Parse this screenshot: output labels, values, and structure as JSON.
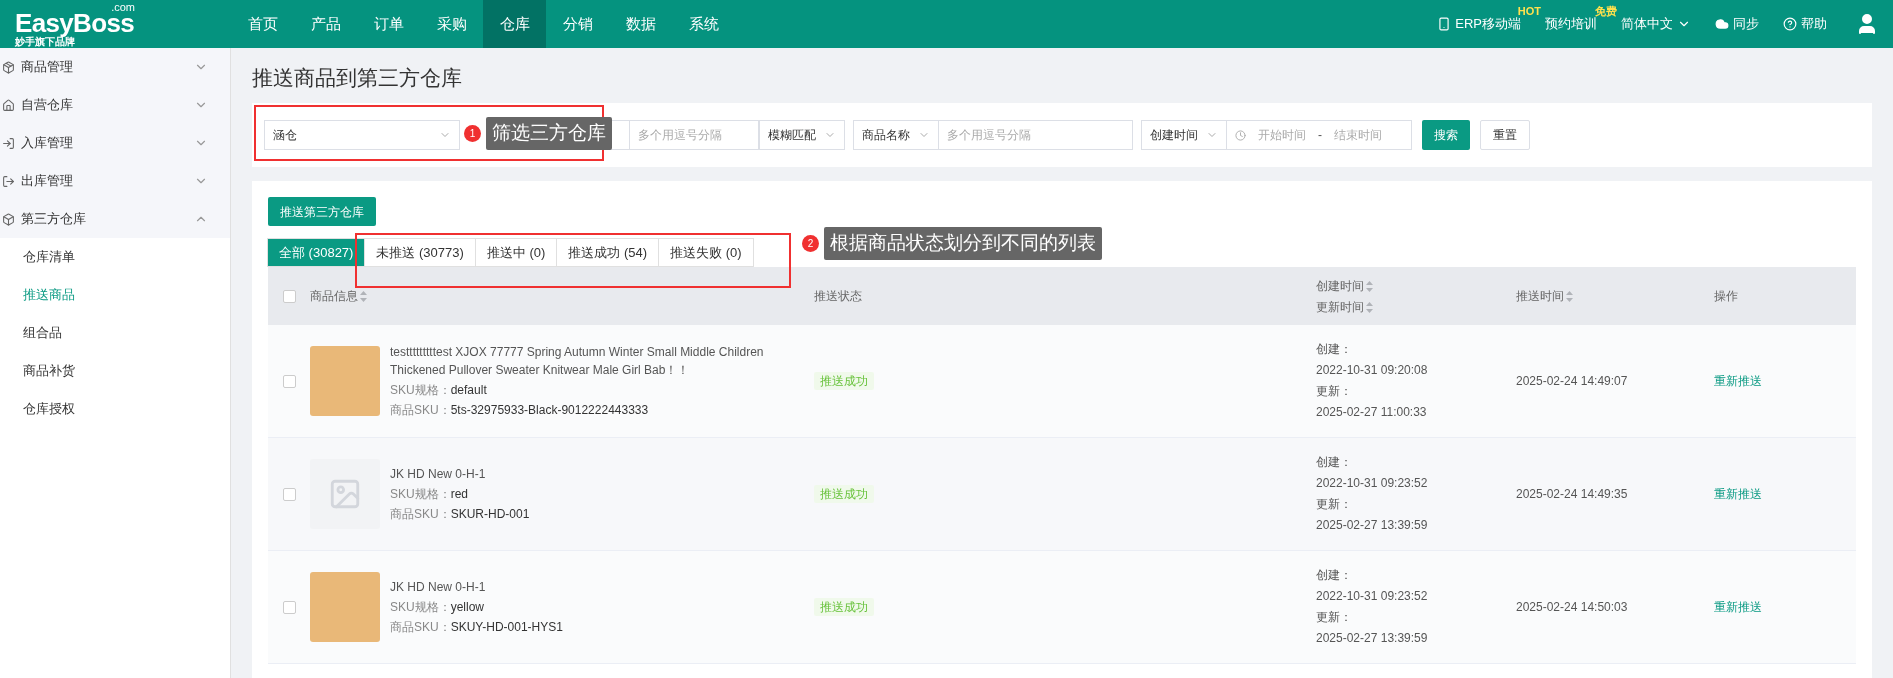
{
  "brand": {
    "name": "EasyBoss",
    "suffix": ".com",
    "tagline": "妙手旗下品牌"
  },
  "nav": [
    {
      "label": "首页",
      "selected": false
    },
    {
      "label": "产品",
      "selected": false
    },
    {
      "label": "订单",
      "selected": false
    },
    {
      "label": "采购",
      "selected": false
    },
    {
      "label": "仓库",
      "selected": true
    },
    {
      "label": "分销",
      "selected": false
    },
    {
      "label": "数据",
      "selected": false
    },
    {
      "label": "系统",
      "selected": false
    }
  ],
  "top_right": [
    {
      "kind": "mobile",
      "label": "ERP移动端",
      "badge": "HOT"
    },
    {
      "kind": "training",
      "label": "预约培训",
      "badge": "免费"
    },
    {
      "kind": "language",
      "label": "简体中文"
    },
    {
      "kind": "sync",
      "label": "同步"
    },
    {
      "kind": "help",
      "label": "帮助"
    },
    {
      "kind": "user"
    }
  ],
  "sidebar": [
    {
      "label": "商品管理",
      "kind": "goods",
      "expanded": false
    },
    {
      "label": "自营仓库",
      "kind": "home",
      "expanded": false
    },
    {
      "label": "入库管理",
      "kind": "in",
      "expanded": false
    },
    {
      "label": "出库管理",
      "kind": "out",
      "expanded": false
    },
    {
      "label": "第三方仓库",
      "kind": "third",
      "expanded": true,
      "children": [
        {
          "label": "仓库清单",
          "selected": false
        },
        {
          "label": "推送商品",
          "selected": true
        },
        {
          "label": "组合品",
          "selected": false
        },
        {
          "label": "商品补货",
          "selected": false
        },
        {
          "label": "仓库授权",
          "selected": false
        }
      ]
    }
  ],
  "page_title": "推送商品到第三方仓库",
  "filters": [
    {
      "kind": "select",
      "value": "涵仓"
    },
    {
      "kind": "select"
    },
    {
      "kind": "input",
      "placeholder": "多个用逗号分隔"
    },
    {
      "kind": "select",
      "value": "模糊匹配"
    },
    {
      "kind": "gap"
    },
    {
      "kind": "select",
      "value": "商品名称"
    },
    {
      "kind": "input",
      "placeholder": "多个用逗号分隔"
    },
    {
      "kind": "gap"
    },
    {
      "kind": "select",
      "value": "创建时间"
    },
    {
      "kind": "daterange",
      "start": "开始时间",
      "sep": "-",
      "end": "结束时间"
    },
    {
      "kind": "primary",
      "label": "搜索"
    },
    {
      "kind": "default",
      "label": "重置"
    }
  ],
  "annotations": [
    {
      "number": "1",
      "text": "筛选三方仓库"
    },
    {
      "number": "2",
      "text": "根据商品状态划分到不同的列表"
    }
  ],
  "push_button": "推送第三方仓库",
  "tabs": [
    {
      "label": "全部 (30827)",
      "selected": true
    },
    {
      "label": "未推送 (30773)",
      "selected": false
    },
    {
      "label": "推送中 (0)",
      "selected": false
    },
    {
      "label": "推送成功 (54)",
      "selected": false
    },
    {
      "label": "推送失败 (0)",
      "selected": false
    }
  ],
  "table": {
    "columns": [
      "商品信息",
      "推送状态",
      "创建时间",
      "更新时间",
      "推送时间",
      "操作"
    ],
    "select_all": {
      "checked": false
    },
    "rows": [
      {
        "kind": "photo",
        "title": "testttttttttest XJOX 77777 Spring Autumn Winter Small Middle Children Thickened Pullover Sweater Knitwear Male Girl Bab！！",
        "spec_label": "SKU规格：",
        "spec": "default",
        "sku_label": "商品SKU：",
        "sku": "5ts-32975933-Black-9012222443333",
        "status": "推送成功",
        "created_label": "创建：",
        "created": "2022-10-31 09:20:08",
        "updated_label": "更新：",
        "updated": "2025-02-27 11:00:33",
        "pushed": "2025-02-24 14:49:07",
        "action": "重新推送",
        "checked": false
      },
      {
        "kind": "placeholder",
        "title": "JK HD New 0-H-1",
        "spec_label": "SKU规格：",
        "spec": "red",
        "sku_label": "商品SKU：",
        "sku": "SKUR-HD-001",
        "status": "推送成功",
        "created_label": "创建：",
        "created": "2022-10-31 09:23:52",
        "updated_label": "更新：",
        "updated": "2025-02-27 13:39:59",
        "pushed": "2025-02-24 14:49:35",
        "action": "重新推送",
        "checked": false
      },
      {
        "kind": "photo",
        "title": "JK HD New 0-H-1",
        "spec_label": "SKU规格：",
        "spec": "yellow",
        "sku_label": "商品SKU：",
        "sku": "SKUY-HD-001-HYS1",
        "status": "推送成功",
        "created_label": "创建：",
        "created": "2022-10-31 09:23:52",
        "updated_label": "更新：",
        "updated": "2025-02-27 13:39:59",
        "pushed": "2025-02-24 14:50:03",
        "action": "重新推送",
        "checked": false
      }
    ]
  }
}
